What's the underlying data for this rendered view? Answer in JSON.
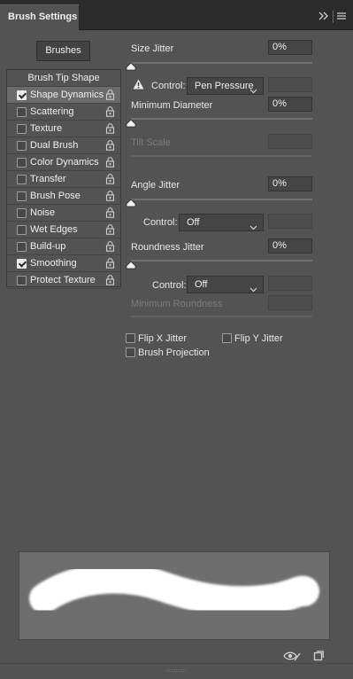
{
  "window": {
    "tab_title": "Brush Settings",
    "collapse_icon": "double-chevron-right-icon",
    "menu_icon": "hamburger-menu-icon"
  },
  "left_panel": {
    "brushes_button": "Brushes",
    "header_item": "Brush Tip Shape",
    "items": [
      {
        "label": "Shape Dynamics",
        "checked": true,
        "selected": true
      },
      {
        "label": "Scattering",
        "checked": false,
        "selected": false
      },
      {
        "label": "Texture",
        "checked": false,
        "selected": false
      },
      {
        "label": "Dual Brush",
        "checked": false,
        "selected": false
      },
      {
        "label": "Color Dynamics",
        "checked": false,
        "selected": false
      },
      {
        "label": "Transfer",
        "checked": false,
        "selected": false
      },
      {
        "label": "Brush Pose",
        "checked": false,
        "selected": false
      },
      {
        "label": "Noise",
        "checked": false,
        "selected": false
      },
      {
        "label": "Wet Edges",
        "checked": false,
        "selected": false
      },
      {
        "label": "Build-up",
        "checked": false,
        "selected": false
      },
      {
        "label": "Smoothing",
        "checked": true,
        "selected": false
      },
      {
        "label": "Protect Texture",
        "checked": false,
        "selected": false
      }
    ]
  },
  "settings": {
    "size_jitter": {
      "label": "Size Jitter",
      "value": "0%",
      "slider_fraction": 0
    },
    "size_control": {
      "label": "Control:",
      "selected": "Pen Pressure",
      "warning_icon": "warning-triangle-icon"
    },
    "minimum_diameter": {
      "label": "Minimum Diameter",
      "value": "0%",
      "slider_fraction": 0
    },
    "tilt_scale": {
      "label": "Tilt Scale"
    },
    "angle_jitter": {
      "label": "Angle Jitter",
      "value": "0%",
      "slider_fraction": 0
    },
    "angle_control": {
      "label": "Control:",
      "selected": "Off"
    },
    "roundness_jitter": {
      "label": "Roundness Jitter",
      "value": "0%",
      "slider_fraction": 0
    },
    "roundness_control": {
      "label": "Control:",
      "selected": "Off"
    },
    "minimum_roundness": {
      "label": "Minimum Roundness"
    },
    "options": {
      "flip_x": {
        "label": "Flip X Jitter",
        "checked": false
      },
      "flip_y": {
        "label": "Flip Y Jitter",
        "checked": false
      },
      "brush_projection": {
        "label": "Brush Projection",
        "checked": false
      }
    }
  },
  "footer": {
    "visibility_icon": "eye-toggle-icon",
    "new_preset_icon": "new-brush-preset-icon"
  },
  "colors": {
    "panel_bg": "#535353",
    "tab_bar_bg": "#2b2b2b",
    "selected_row": "#6b6b6b",
    "field_bg": "#454545",
    "preview_bg": "#6e6e6e",
    "stroke": "#ffffff"
  }
}
